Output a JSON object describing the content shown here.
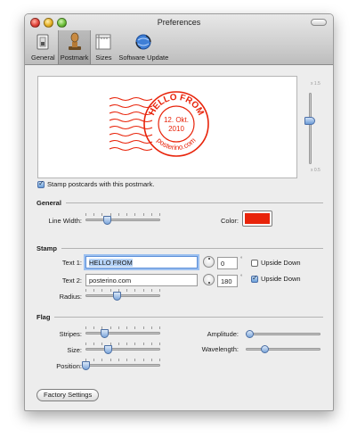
{
  "window": {
    "title": "Preferences"
  },
  "tabs": [
    {
      "label": "General",
      "icon": "switch-icon"
    },
    {
      "label": "Postmark",
      "icon": "stamp-icon"
    },
    {
      "label": "Sizes",
      "icon": "ruler-icon"
    },
    {
      "label": "Software Update",
      "icon": "globe-update-icon"
    }
  ],
  "selected_tab": "Postmark",
  "preview": {
    "stamp_top": "HELLO FROM",
    "stamp_date": "12. Okt.",
    "stamp_year": "2010",
    "stamp_bottom": "posterino.com",
    "scale_max": "x 1.5",
    "scale_min": "x 0.5",
    "scale_value": 0.6,
    "stamp_color": "#e8230a"
  },
  "stamp_checkbox": {
    "label": "Stamp postcards with this postmark.",
    "checked": true
  },
  "general": {
    "heading": "General",
    "line_width_label": "Line Width:",
    "line_width_value": 0.28,
    "color_label": "Color:",
    "color": "#e8230a"
  },
  "stamp": {
    "heading": "Stamp",
    "text1_label": "Text 1:",
    "text1_value": "HELLO FROM",
    "text1_angle": "0",
    "text1_upside_down": false,
    "text2_label": "Text 2:",
    "text2_value": "posterino.com",
    "text2_angle": "180",
    "text2_upside_down": true,
    "upside_down_label": "Upside Down",
    "degree_symbol": "°",
    "radius_label": "Radius:",
    "radius_value": 0.42
  },
  "flag": {
    "heading": "Flag",
    "stripes_label": "Stripes:",
    "stripes_value": 0.25,
    "size_label": "Size:",
    "size_value": 0.3,
    "position_label": "Position:",
    "position_value": 0.0,
    "amplitude_label": "Amplitude:",
    "amplitude_value": 0.05,
    "wavelength_label": "Wavelength:",
    "wavelength_value": 0.25
  },
  "factory_button": "Factory Settings"
}
